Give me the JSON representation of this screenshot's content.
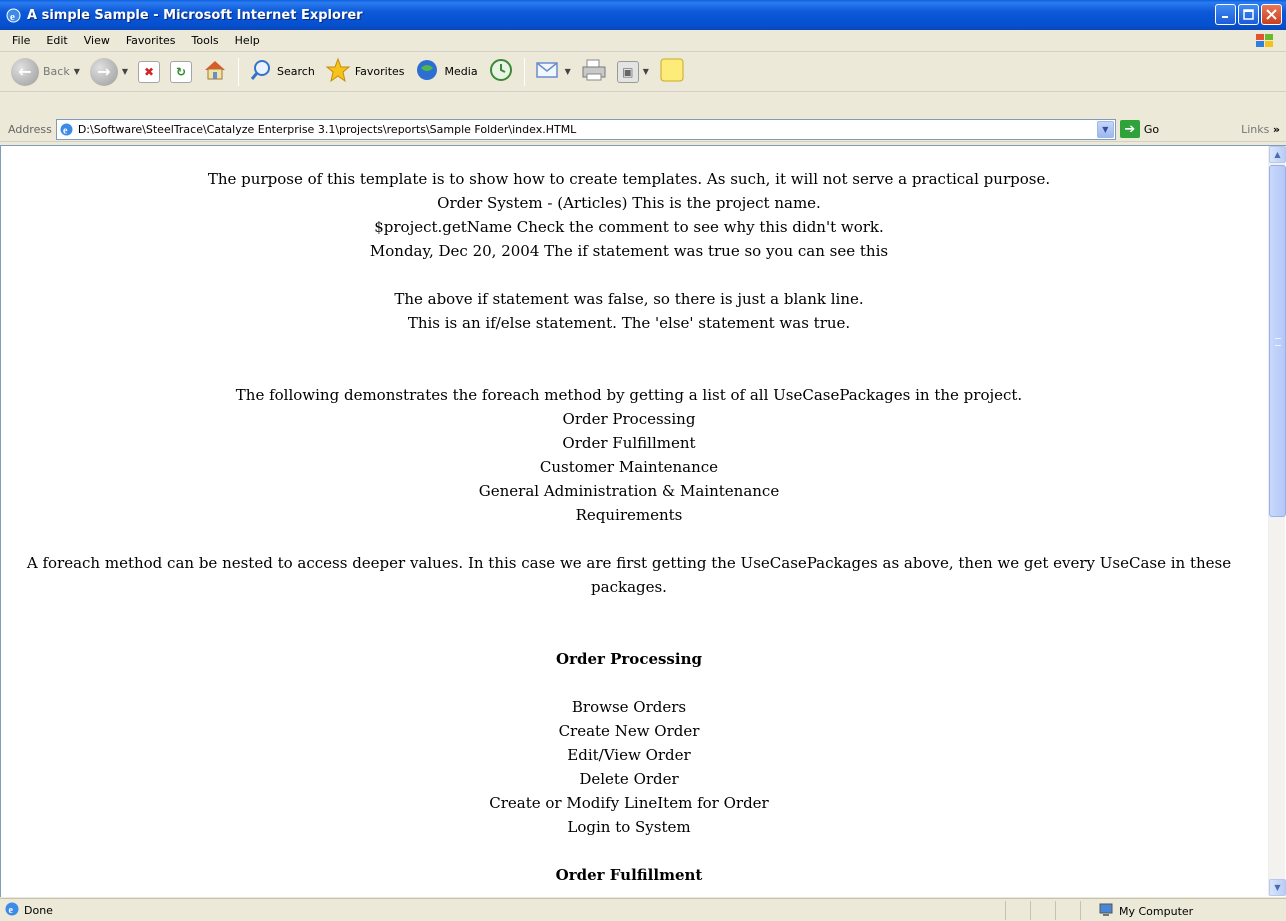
{
  "window": {
    "title": "A simple Sample - Microsoft Internet Explorer"
  },
  "menu": [
    "File",
    "Edit",
    "View",
    "Favorites",
    "Tools",
    "Help"
  ],
  "toolbar": {
    "back_label": "Back",
    "search_label": "Search",
    "favorites_label": "Favorites",
    "media_label": "Media"
  },
  "address": {
    "label": "Address",
    "url": "D:\\Software\\SteelTrace\\Catalyze Enterprise 3.1\\projects\\reports\\Sample Folder\\index.HTML",
    "go_label": "Go",
    "links_label": "Links"
  },
  "content": {
    "line1": "The purpose of this template is to show how to create templates. As such, it will not serve a practical purpose.",
    "line2": "Order System - (Articles) This is the project name.",
    "line3": "$project.getName Check the comment to see why this didn't work.",
    "line4": "Monday, Dec 20, 2004 The if statement was true so you can see this",
    "line5": "The above if statement was false, so there is just a blank line.",
    "line6": "This is an if/else statement. The 'else' statement was true.",
    "foreach_intro": "The following demonstrates the foreach method by getting a list of all UseCasePackages in the project.",
    "packages": [
      "Order Processing",
      "Order Fulfillment",
      "Customer Maintenance",
      "General Administration & Maintenance",
      "Requirements"
    ],
    "nested_intro": "A foreach method can be nested to access deeper values. In this case we are first getting the UseCasePackages as above, then we get every UseCase in these packages.",
    "group1_title": "Order Processing",
    "group1_items": [
      "Browse Orders",
      "Create New Order",
      "Edit/View Order",
      "Delete Order",
      "Create or Modify LineItem for Order",
      "Login to System"
    ],
    "group2_title": "Order Fulfillment"
  },
  "status": {
    "left": "Done",
    "zone": "My Computer"
  }
}
